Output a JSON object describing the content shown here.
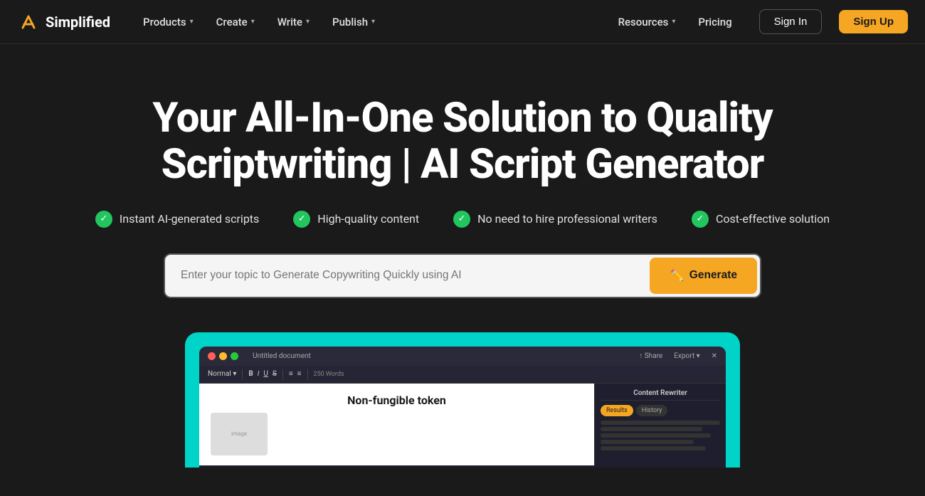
{
  "brand": {
    "name": "Simplified",
    "logo_icon": "⚡"
  },
  "navbar": {
    "items": [
      {
        "label": "Products",
        "has_dropdown": true
      },
      {
        "label": "Create",
        "has_dropdown": true
      },
      {
        "label": "Write",
        "has_dropdown": true
      },
      {
        "label": "Publish",
        "has_dropdown": true
      }
    ],
    "right_items": [
      {
        "label": "Resources",
        "has_dropdown": true
      },
      {
        "label": "Pricing",
        "has_dropdown": false
      }
    ],
    "signin_label": "Sign In",
    "signup_label": "Sign Up"
  },
  "hero": {
    "title": "Your All-In-One Solution to Quality Scriptwriting | AI Script Generator",
    "features": [
      {
        "label": "Instant AI-generated scripts"
      },
      {
        "label": "High-quality content"
      },
      {
        "label": "No need to hire professional writers"
      },
      {
        "label": "Cost-effective solution"
      }
    ],
    "input_placeholder": "Enter your topic to Generate Copywriting Quickly using AI",
    "generate_label": "Generate",
    "generate_icon": "✏️"
  },
  "app_preview": {
    "editor_title": "Non-fungible token",
    "toolbar_text": "Normal  I  B  I  U  S  ≡  ≡  ≡  250 Words",
    "panel_title": "Content Rewriter",
    "tab_results": "Results",
    "tab_history": "History"
  },
  "colors": {
    "accent_orange": "#f5a623",
    "accent_teal": "#00d4c8",
    "check_green": "#22c55e",
    "bg_dark": "#1a1a1a"
  }
}
